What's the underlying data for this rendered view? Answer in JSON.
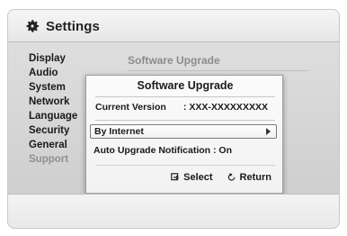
{
  "window": {
    "title": "Settings",
    "title_icon": "gear-icon"
  },
  "sidebar": {
    "items": [
      {
        "label": "Display",
        "state": "normal"
      },
      {
        "label": "Audio",
        "state": "normal"
      },
      {
        "label": "System",
        "state": "normal"
      },
      {
        "label": "Network",
        "state": "normal"
      },
      {
        "label": "Language",
        "state": "normal"
      },
      {
        "label": "Security",
        "state": "normal"
      },
      {
        "label": "General",
        "state": "normal"
      },
      {
        "label": "Support",
        "state": "disabled"
      }
    ]
  },
  "main": {
    "submenu_title": "Software Upgrade"
  },
  "dialog": {
    "title": "Software Upgrade",
    "current_version_label": "Current Version",
    "current_version_value": ": XXX-XXXXXXXXX",
    "options": [
      {
        "label": "By Internet",
        "selected": true,
        "arrow_icon": "chevron-right-icon"
      }
    ],
    "auto_upgrade_label": "Auto Upgrade Notification : On",
    "actions": [
      {
        "label": "Select",
        "icon": "select-icon"
      },
      {
        "label": "Return",
        "icon": "return-icon"
      }
    ]
  },
  "colors": {
    "background": "#ffffff",
    "frame": "#d6d6d6",
    "text": "#1a1a1a",
    "disabled_text": "#8f8f8f"
  }
}
